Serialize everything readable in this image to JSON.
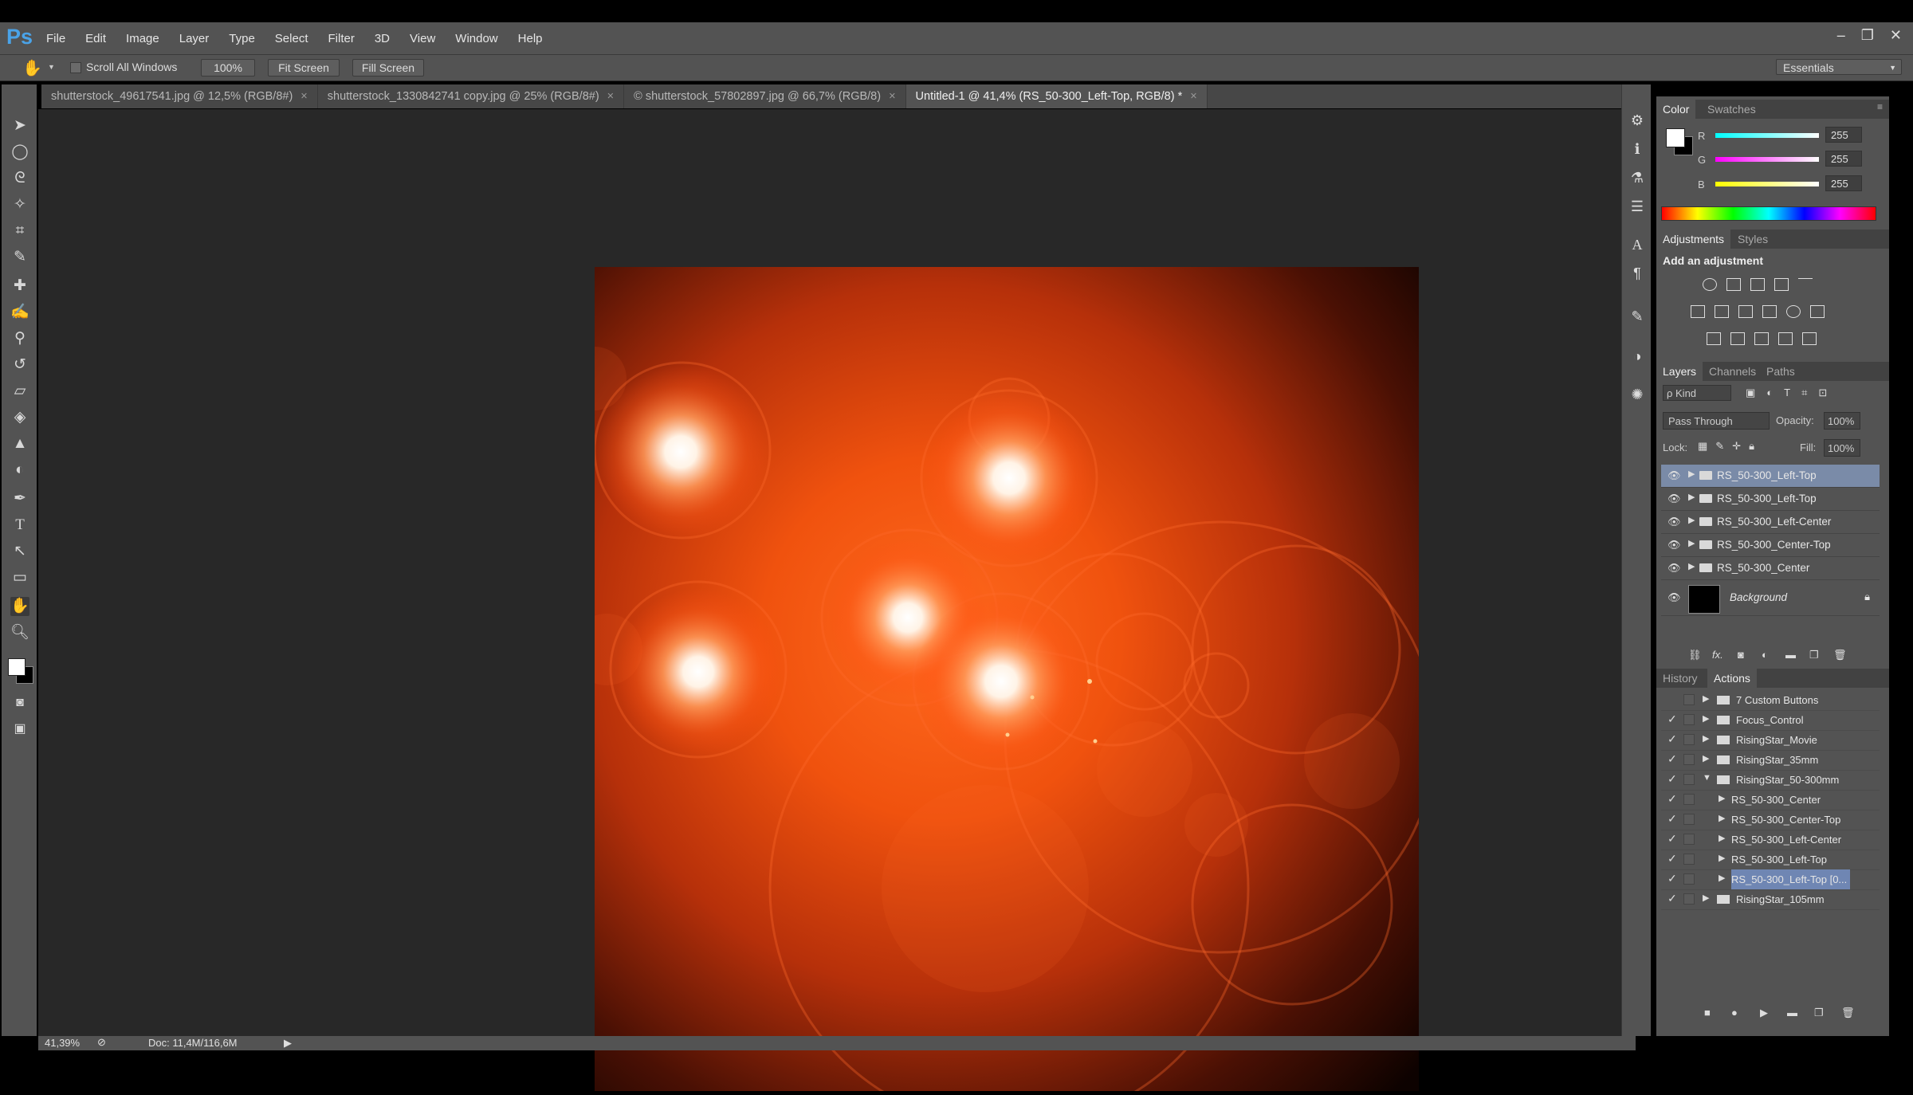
{
  "app": {
    "logo": "Ps"
  },
  "menu": [
    "File",
    "Edit",
    "Image",
    "Layer",
    "Type",
    "Select",
    "Filter",
    "3D",
    "View",
    "Window",
    "Help"
  ],
  "window_controls": [
    "–",
    "❐",
    "✕"
  ],
  "options": {
    "scroll_all_label": "Scroll All Windows",
    "zoom_btn": "100%",
    "fit_btn": "Fit Screen",
    "fill_btn": "Fill Screen",
    "workspace": "Essentials"
  },
  "tabs": [
    {
      "label": "shutterstock_49617541.jpg @ 12,5% (RGB/8#)",
      "close": "×"
    },
    {
      "label": "shutterstock_1330842741 copy.jpg @ 25% (RGB/8#)",
      "close": "×"
    },
    {
      "label": "© shutterstock_57802897.jpg @ 66,7% (RGB/8)",
      "close": "×"
    },
    {
      "label": "Untitled-1 @ 41,4% (RS_50-300_Left-Top, RGB/8) *",
      "close": "×"
    }
  ],
  "color_panel": {
    "tabs": [
      "Color",
      "Swatches"
    ],
    "r_label": "R",
    "g_label": "G",
    "b_label": "B",
    "r": "255",
    "g": "255",
    "b": "255"
  },
  "adjustments_panel": {
    "tabs": [
      "Adjustments",
      "Styles"
    ],
    "heading": "Add an adjustment"
  },
  "layers_panel": {
    "tabs": [
      "Layers",
      "Channels",
      "Paths"
    ],
    "kind": "ρ Kind",
    "blend_mode": "Pass Through",
    "opacity_label": "Opacity:",
    "opacity": "100%",
    "lock_label": "Lock:",
    "fill_label": "Fill:",
    "fill": "100%",
    "layers": [
      {
        "name": "RS_50-300_Left-Top",
        "selected": true
      },
      {
        "name": "RS_50-300_Left-Top",
        "selected": false
      },
      {
        "name": "RS_50-300_Left-Center",
        "selected": false
      },
      {
        "name": "RS_50-300_Center-Top",
        "selected": false
      },
      {
        "name": "RS_50-300_Center",
        "selected": false
      }
    ],
    "background_name": "Background",
    "footer_fx": "fx."
  },
  "actions_panel": {
    "tabs": [
      "History",
      "Actions"
    ],
    "items": [
      {
        "name": "7 Custom Buttons",
        "checked": false,
        "level": 0,
        "expanded": false
      },
      {
        "name": "Focus_Control",
        "checked": true,
        "level": 0,
        "expanded": false
      },
      {
        "name": "RisingStar_Movie",
        "checked": true,
        "level": 0,
        "expanded": false
      },
      {
        "name": "RisingStar_35mm",
        "checked": true,
        "level": 0,
        "expanded": false
      },
      {
        "name": "RisingStar_50-300mm",
        "checked": true,
        "level": 0,
        "expanded": true
      },
      {
        "name": "RS_50-300_Center",
        "checked": true,
        "level": 1,
        "expanded": false
      },
      {
        "name": "RS_50-300_Center-Top",
        "checked": true,
        "level": 1,
        "expanded": false
      },
      {
        "name": "RS_50-300_Left-Center",
        "checked": true,
        "level": 1,
        "expanded": false
      },
      {
        "name": "RS_50-300_Left-Top",
        "checked": true,
        "level": 1,
        "expanded": false
      },
      {
        "name": "RS_50-300_Left-Top [0...",
        "checked": true,
        "level": 1,
        "expanded": false,
        "selected": true
      },
      {
        "name": "RisingStar_105mm",
        "checked": true,
        "level": 0,
        "expanded": false
      }
    ]
  },
  "status": {
    "zoom": "41,39%",
    "doc": "Doc: 11,4M/116,6M"
  },
  "colors": {
    "ui_gray": "#535353",
    "workspace": "#282828",
    "selection": "#7a8ba8",
    "canvas_orange": "#e24a0c"
  }
}
